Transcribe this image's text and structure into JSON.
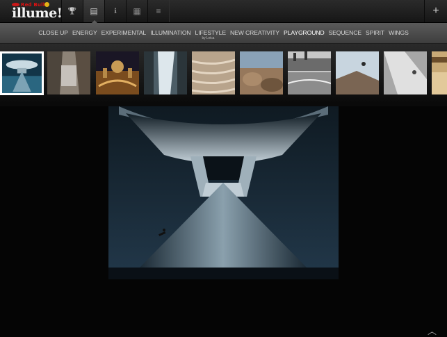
{
  "app": {
    "logo_brand": "Red Bull",
    "logo_word": "illume!"
  },
  "toolbar": {
    "buttons": [
      {
        "name": "trophy-icon",
        "glyph": "🏆"
      },
      {
        "name": "gallery-icon",
        "glyph": "▤"
      },
      {
        "name": "info-icon",
        "glyph": "ℹ"
      },
      {
        "name": "calendar-icon",
        "glyph": "▦"
      },
      {
        "name": "list-icon",
        "glyph": "≡"
      }
    ],
    "plus": "+"
  },
  "categories": [
    {
      "label": "CLOSE UP"
    },
    {
      "label": "ENERGY"
    },
    {
      "label": "EXPERIMENTAL"
    },
    {
      "label": "ILLUMINATION"
    },
    {
      "label": "LIFESTYLE",
      "sub": "by Leica"
    },
    {
      "label": "NEW CREATIVITY"
    },
    {
      "label": "PLAYGROUND",
      "active": true
    },
    {
      "label": "SEQUENCE"
    },
    {
      "label": "SPIRIT"
    },
    {
      "label": "WINGS"
    }
  ],
  "scroll_up_icon": "︿"
}
